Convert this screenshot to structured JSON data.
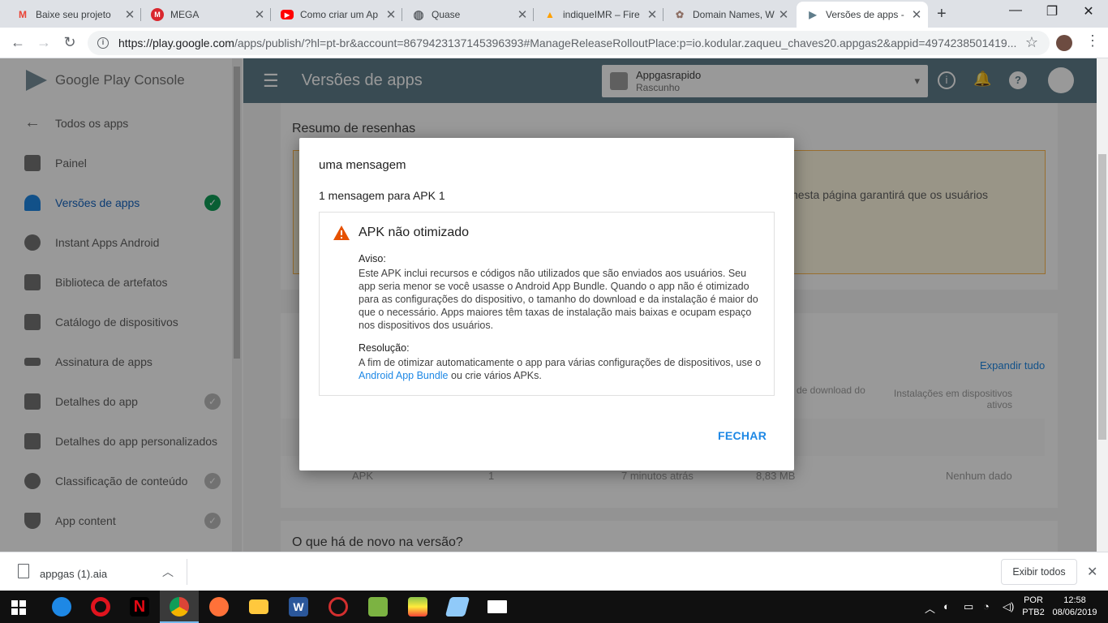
{
  "browser": {
    "tabs": [
      {
        "title": "Baixe seu projeto",
        "icon": "gmail-icon",
        "fav": "M",
        "color": "#ea4335"
      },
      {
        "title": "MEGA",
        "icon": "mega-icon",
        "fav": "M",
        "color": "#d9272e"
      },
      {
        "title": "Como criar um Ap",
        "icon": "youtube-icon",
        "fav": "▶",
        "color": "#ff0000"
      },
      {
        "title": "Quase",
        "icon": "globe-icon",
        "fav": "◍",
        "color": "#5f6368"
      },
      {
        "title": "indiqueIMR – Fire",
        "icon": "firebase-icon",
        "fav": "▲",
        "color": "#ffa000"
      },
      {
        "title": "Domain Names, W",
        "icon": "domain-icon",
        "fav": "✿",
        "color": "#8d6e63"
      },
      {
        "title": "Versões de apps -",
        "icon": "play-console-icon",
        "fav": "▶",
        "color": "#607d8b"
      }
    ],
    "url_host": "https://play.google.com",
    "url_rest": "/apps/publish/?hl=pt-br&account=8679423137145396393#ManageReleaseRolloutPlace:p=io.kodular.zaqueu_chaves20.appgas2&appid=4974238501419..."
  },
  "sidebar": {
    "logo": "Google Play Console",
    "items": [
      {
        "label": "Todos os apps",
        "icon": "arrow-back-icon",
        "check": false
      },
      {
        "label": "Painel",
        "icon": "dashboard-icon",
        "check": false
      },
      {
        "label": "Versões de apps",
        "icon": "rocket-icon",
        "check": true
      },
      {
        "label": "Instant Apps Android",
        "icon": "bolt-icon",
        "check": false
      },
      {
        "label": "Biblioteca de artefatos",
        "icon": "library-icon",
        "check": false
      },
      {
        "label": "Catálogo de dispositivos",
        "icon": "device-icon",
        "check": false
      },
      {
        "label": "Assinatura de apps",
        "icon": "key-icon",
        "check": false
      },
      {
        "label": "Detalhes do app",
        "icon": "store-icon",
        "check": true
      },
      {
        "label": "Detalhes do app personalizados",
        "icon": "store-icon",
        "check": false
      },
      {
        "label": "Classificação de conteúdo",
        "icon": "rating-icon",
        "check": true
      },
      {
        "label": "App content",
        "icon": "shield-icon",
        "check": true
      }
    ]
  },
  "header": {
    "title": "Versões de apps",
    "app_name": "Appgasrapido",
    "app_status": "Rascunho"
  },
  "background": {
    "card1_title": "Resumo de resenhas",
    "card1_text": "nesta página garantirá que os usuários",
    "expand_label": "Expandir tudo",
    "col_download": "de download do",
    "col_installs": "Instalações em dispositivos ativos",
    "row_type": "APK",
    "row_count": "1",
    "row_time": "7 minutos atrás",
    "row_size": "8,83 MB",
    "row_nodata": "Nenhum dado",
    "card3_title": "O que há de novo na versão?"
  },
  "dialog": {
    "title": "uma mensagem",
    "subtitle": "1 mensagem para APK 1",
    "message_title": "APK não otimizado",
    "warning_label": "Aviso:",
    "warning_text": "Este APK inclui recursos e códigos não utilizados que são enviados aos usuários. Seu app seria menor se você usasse o Android App Bundle. Quando o app não é otimizado para as configurações do dispositivo, o tamanho do download e da instalação é maior do que o necessário. Apps maiores têm taxas de instalação mais baixas e ocupam espaço nos dispositivos dos usuários.",
    "resolution_label": "Resolução:",
    "resolution_text_before": "A fim de otimizar automaticamente o app para várias configurações de dispositivos, use o",
    "resolution_link": "Android App Bundle",
    "resolution_text_after": "ou crie vários APKs.",
    "close_label": "FECHAR"
  },
  "downloads": {
    "file": "appgas (1).aia",
    "show_all": "Exibir todos"
  },
  "taskbar": {
    "apps": [
      {
        "name": "edge-icon",
        "color": "#1e88e5"
      },
      {
        "name": "opera-icon",
        "color": "#e0141e"
      },
      {
        "name": "netflix-icon",
        "color": "#e50914"
      },
      {
        "name": "chrome-icon",
        "color": "#4caf50"
      },
      {
        "name": "firefox-icon",
        "color": "#ff7139"
      },
      {
        "name": "file-explorer-icon",
        "color": "#ffc83d"
      },
      {
        "name": "word-icon",
        "color": "#2b579a"
      },
      {
        "name": "app-icon",
        "color": "#d32f2f"
      },
      {
        "name": "notepad-icon",
        "color": "#7cb342"
      },
      {
        "name": "bluestacks-icon",
        "color": "#8bc34a"
      },
      {
        "name": "paint-icon",
        "color": "#90caf9"
      },
      {
        "name": "mail-icon",
        "color": "#ffffff"
      }
    ],
    "lang": "POR",
    "layout": "PTB2",
    "time": "12:58",
    "date": "08/06/2019"
  }
}
